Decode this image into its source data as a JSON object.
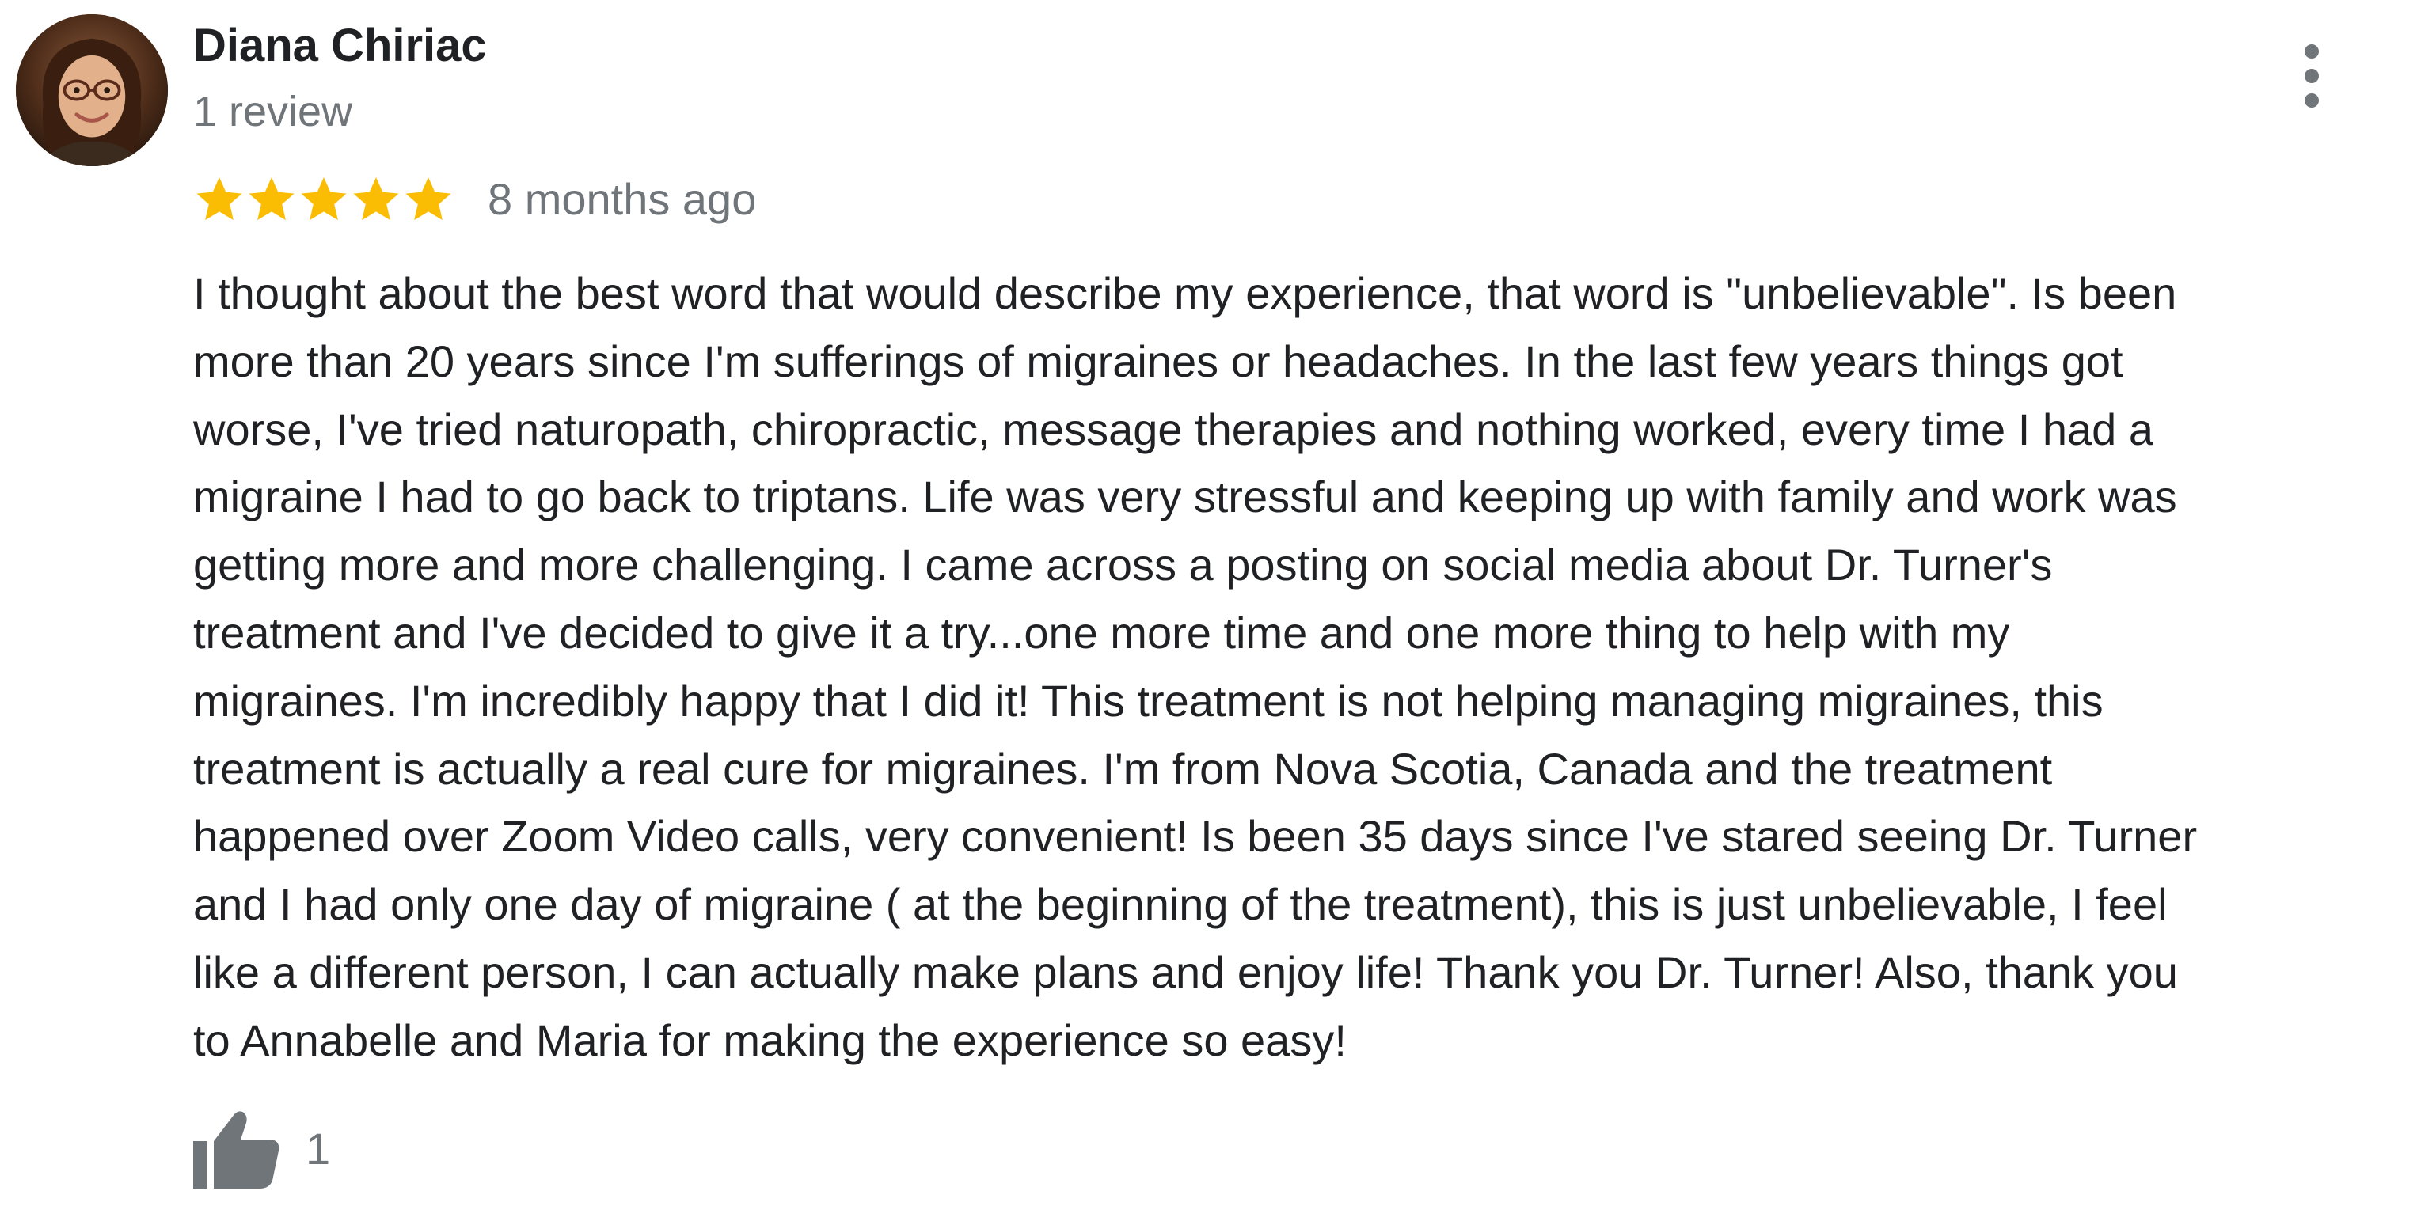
{
  "review": {
    "author": {
      "name": "Diana Chiriac",
      "review_count": "1 review",
      "avatar_icon": "user-photo-avatar"
    },
    "rating": {
      "stars": 5,
      "max": 5,
      "star_color": "#fbbc04",
      "star_icon": "star-icon"
    },
    "time": "8 months ago",
    "text_lines": [
      "I thought about the best word that would describe my experience, that word is \"unbelievable\". Is been",
      "more than 20 years since I'm sufferings of migraines or headaches. In the last few years things got",
      "worse, I've tried naturopath, chiropractic, message therapies and nothing worked, every time I had a",
      "migraine I had to go back to triptans. Life was very stressful and keeping up with family and work was",
      "getting more and more challenging. I came across a posting on social media about Dr. Turner's",
      "treatment and I've decided to give it a try...one more time and one more thing to help with my",
      "migraines. I'm incredibly happy that I did it! This treatment is not helping managing migraines, this",
      "treatment is actually a real cure for migraines. I'm from Nova Scotia, Canada and the treatment",
      "happened over Zoom Video calls, very convenient! Is been 35 days since I've stared seeing Dr. Turner",
      "and I had only one day of migraine ( at the beginning of the treatment), this is just unbelievable, I feel",
      "like a different person, I can actually make plans and enjoy life! Thank you Dr. Turner! Also, thank you",
      "to Annabelle and Maria for making the experience so easy!"
    ],
    "likes": {
      "count": "1",
      "icon": "thumbs-up-icon"
    },
    "menu_icon": "more-vert-icon"
  },
  "colors": {
    "text_primary": "#202124",
    "text_secondary": "#70757a",
    "star": "#fbbc04",
    "icon_gray": "#70757a"
  }
}
